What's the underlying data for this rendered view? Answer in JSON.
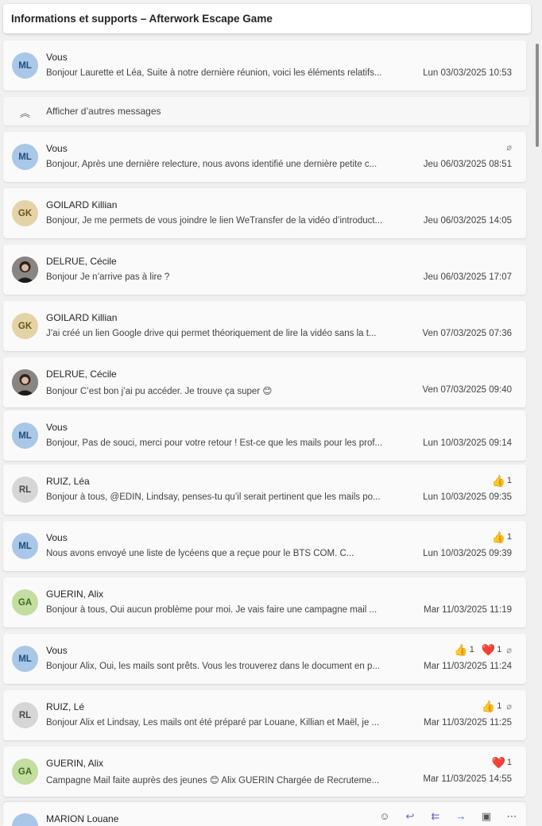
{
  "thread": {
    "title": "Informations et supports – Afterwork Escape Game"
  },
  "show_more": {
    "label": "Afficher d’autres messages",
    "icon": "double-chevron-up-icon"
  },
  "messages": [
    {
      "initials": "ML",
      "avatar_bg": "#a9c7e8",
      "avatar_fg": "#1f4e7a",
      "sender": "Vous",
      "preview": "Bonjour Laurette et Léa, Suite à notre dernière réunion, voici les éléments relatifs...",
      "date": "Lun 03/03/2025 10:53"
    },
    {
      "initials": "ML",
      "avatar_bg": "#a9c7e8",
      "avatar_fg": "#1f4e7a",
      "sender": "Vous",
      "preview": "Bonjour, Après une dernière relecture, nous avons identifié une dernière petite c...",
      "date": "Jeu 06/03/2025 08:51",
      "attachment": "paperclip-icon"
    },
    {
      "initials": "GK",
      "avatar_bg": "#e5d3a8",
      "avatar_fg": "#6b5318",
      "sender": "GOILARD Killian",
      "preview": "Bonjour, Je me permets de vous joindre le lien WeTransfer de la vidéo d’introduct...",
      "date": "Jeu 06/03/2025 14:05"
    },
    {
      "initials": "",
      "photo": true,
      "sender": "DELRUE, Cécile",
      "preview": "Bonjour Je n’arrive pas à lire ?",
      "date": "Jeu 06/03/2025 17:07"
    },
    {
      "initials": "GK",
      "avatar_bg": "#e5d3a8",
      "avatar_fg": "#6b5318",
      "sender": "GOILARD Killian",
      "preview": "J’ai créé un lien Google drive qui permet théoriquement de lire la vidéo sans la t...",
      "date": "Ven 07/03/2025 07:36"
    },
    {
      "initials": "",
      "photo": true,
      "sender": "DELRUE, Cécile",
      "preview": "Bonjour C’est bon j’ai pu accéder. Je trouve ça super 😊",
      "date": "Ven 07/03/2025 09:40"
    },
    {
      "initials": "ML",
      "avatar_bg": "#a9c7e8",
      "avatar_fg": "#1f4e7a",
      "sender": "Vous",
      "preview": "Bonjour, Pas de souci, merci pour votre retour ! Est-ce que les mails pour les prof...",
      "date": "Lun 10/03/2025 09:14"
    },
    {
      "initials": "RL",
      "avatar_bg": "#d6d6d6",
      "avatar_fg": "#4a4a4a",
      "sender": "RUIZ, Léa",
      "preview": "Bonjour à tous, @EDIN, Lindsay, penses-tu qu’il serait pertinent que les mails po...",
      "date": "Lun 10/03/2025 09:35",
      "reactions": [
        {
          "emoji": "👍",
          "count": "1"
        }
      ]
    },
    {
      "initials": "ML",
      "avatar_bg": "#a9c7e8",
      "avatar_fg": "#1f4e7a",
      "sender": "Vous",
      "preview": "Nous avons envoyé une liste de lycéens que                   a reçue pour le BTS COM. C...",
      "date": "Lun 10/03/2025 09:39",
      "reactions": [
        {
          "emoji": "👍",
          "count": "1"
        }
      ]
    },
    {
      "initials": "GA",
      "avatar_bg": "#c3dea0",
      "avatar_fg": "#3f6b1c",
      "sender": "GUERIN, Alix",
      "preview": "Bonjour à tous, Oui aucun problème pour moi. Je vais faire une campagne mail ...",
      "date": "Mar 11/03/2025 11:19"
    },
    {
      "initials": "ML",
      "avatar_bg": "#a9c7e8",
      "avatar_fg": "#1f4e7a",
      "sender": "Vous",
      "preview": "Bonjour Alix, Oui, les mails sont prêts. Vous les trouverez dans le document en p...",
      "date": "Mar 11/03/2025 11:24",
      "reactions": [
        {
          "emoji": "👍",
          "count": "1"
        },
        {
          "emoji": "❤️",
          "count": "1"
        }
      ],
      "attachment": "paperclip-icon"
    },
    {
      "initials": "RL",
      "avatar_bg": "#d6d6d6",
      "avatar_fg": "#4a4a4a",
      "sender": "RUIZ, Lé",
      "preview": "Bonjour Alix et Lindsay, Les mails ont été préparé par Louane, Killian et Maël, je ...",
      "date": "Mar 11/03/2025 11:25",
      "reactions": [
        {
          "emoji": "👍",
          "count": "1"
        }
      ],
      "attachment": "paperclip-icon"
    },
    {
      "initials": "GA",
      "avatar_bg": "#c3dea0",
      "avatar_fg": "#3f6b1c",
      "sender": "GUERIN, Alix",
      "preview": "Campagne Mail faite auprès des jeunes 😊 Alix GUERIN Chargée de Recruteme...",
      "date": "Mar 11/03/2025 14:55",
      "reactions": [
        {
          "emoji": "❤️",
          "count": "1"
        }
      ]
    }
  ],
  "compose": {
    "sender": "MARION Louane",
    "avatar_bg": "#a9c7e8",
    "tools": [
      "smiley-icon",
      "reply-icon",
      "reply-all-icon",
      "forward-icon",
      "teams-icon",
      "more-icon"
    ]
  }
}
